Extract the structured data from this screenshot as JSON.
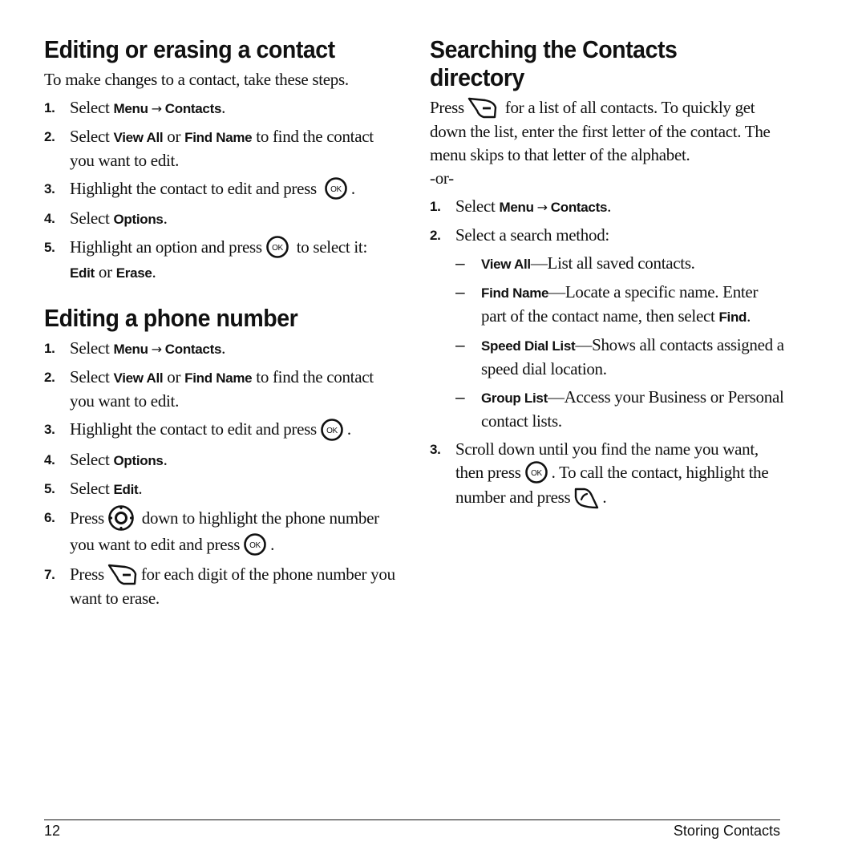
{
  "left": {
    "section1": {
      "title": "Editing or erasing a contact",
      "intro": "To make changes to a contact, take these steps.",
      "steps": [
        {
          "num": "1.",
          "pre": "Select ",
          "b1": "Menu",
          "arrow": "→",
          "b2": "Contacts",
          "post": "."
        },
        {
          "num": "2.",
          "pre": "Select ",
          "b1": "View All",
          "mid": " or ",
          "b2": "Find Name",
          "post": " to find the contact you want to edit."
        },
        {
          "num": "3.",
          "pre": "Highlight the contact to edit and press",
          "post": "."
        },
        {
          "num": "4.",
          "pre": "Select ",
          "b1": "Options",
          "post": "."
        },
        {
          "num": "5.",
          "pre": "Highlight an option and press",
          "mid": " to select it: ",
          "b1": "Edit",
          "mid2": " or ",
          "b2": "Erase",
          "post": "."
        }
      ]
    },
    "section2": {
      "title": "Editing a phone number",
      "steps": [
        {
          "num": "1.",
          "pre": "Select ",
          "b1": "Menu",
          "arrow": "→",
          "b2": "Contacts",
          "post": "."
        },
        {
          "num": "2.",
          "pre": "Select ",
          "b1": "View All",
          "mid": " or ",
          "b2": "Find Name",
          "post": " to find the contact you want to edit."
        },
        {
          "num": "3.",
          "pre": "Highlight the contact to edit and press",
          "post": "."
        },
        {
          "num": "4.",
          "pre": "Select ",
          "b1": "Options",
          "post": "."
        },
        {
          "num": "5.",
          "pre": "Select ",
          "b1": "Edit",
          "post": "."
        },
        {
          "num": "6.",
          "pre": "Press",
          "mid": " down to highlight the phone number you want to edit and press",
          "post": "."
        },
        {
          "num": "7.",
          "pre": "Press",
          "post": "for each digit of the phone number you want to erase."
        }
      ]
    }
  },
  "right": {
    "section3": {
      "title": "Searching the Contacts directory",
      "intro_pre": "Press",
      "intro_post": " for a list of all contacts. To quickly get down the list, enter the first letter of the contact. The menu skips to that letter of the alphabet.",
      "or": "-or-",
      "steps": [
        {
          "num": "1.",
          "pre": "Select ",
          "b1": "Menu",
          "arrow": "→",
          "b2": "Contacts",
          "post": "."
        },
        {
          "num": "2.",
          "pre": "Select a search method:"
        },
        {
          "num": "3.",
          "pre": "Scroll down until you find the name you want, then press",
          "mid": ". To call the contact, highlight the number and press",
          "post": "."
        }
      ],
      "methods": [
        {
          "dash": "–",
          "label": "View All",
          "text": "—List all saved contacts."
        },
        {
          "dash": "–",
          "label": "Find Name",
          "text": "—Locate a specific name. Enter part of the contact name, then select ",
          "b": "Find",
          "post": "."
        },
        {
          "dash": "–",
          "label": "Speed Dial List",
          "text": "—Shows all contacts assigned a speed dial location."
        },
        {
          "dash": "–",
          "label": "Group List",
          "text": "—Access your Business or Personal contact lists."
        }
      ]
    }
  },
  "footer": {
    "page_number": "12",
    "chapter": "Storing Contacts"
  },
  "icons": {
    "ok": "ok-key-icon",
    "nav": "navigation-key-icon",
    "clear": "clear-key-icon",
    "send": "send-key-icon"
  }
}
